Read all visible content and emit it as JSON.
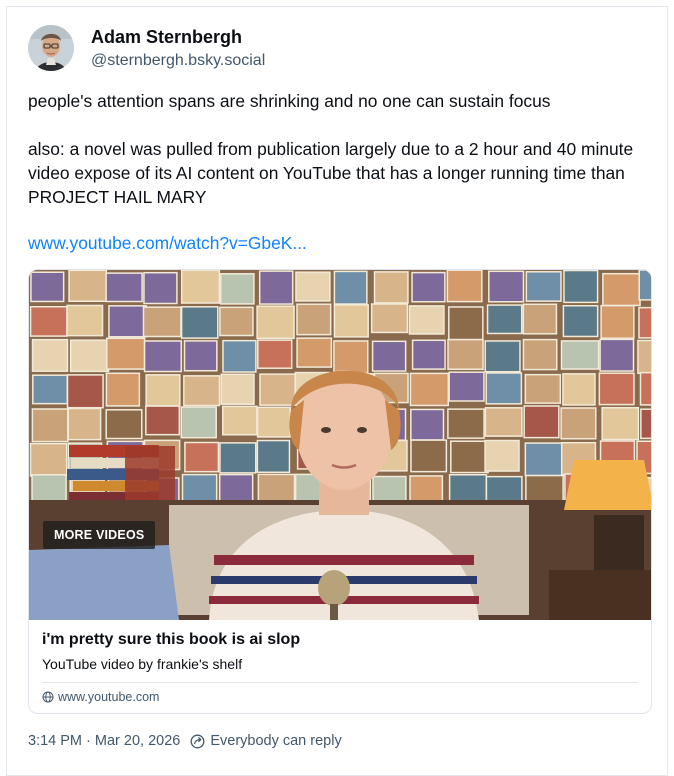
{
  "author": {
    "display_name": "Adam Sternbergh",
    "handle": "@sternbergh.bsky.social"
  },
  "post": {
    "paragraph1": "people's attention spans are shrinking and no one can sustain focus",
    "paragraph2": "also: a novel was pulled from publication largely due to a 2 hour and 40 minute video expose of its AI content on YouTube that has a longer running time than PROJECT HAIL MARY",
    "link_text": "www.youtube.com/watch?v=GbeK..."
  },
  "embed": {
    "overlay_label": "MORE VIDEOS",
    "title": "i'm pretty sure this book is ai slop",
    "description": "YouTube video by frankie's shelf",
    "domain": "www.youtube.com"
  },
  "footer": {
    "timestamp": "3:14 PM · Mar 20, 2026",
    "reply_status": "Everybody can reply"
  },
  "colors": {
    "link": "#1083fe",
    "muted_text": "#42576c",
    "border": "#e3e8ee"
  },
  "icons": [
    "avatar",
    "globe-icon",
    "reply-settings-icon"
  ]
}
